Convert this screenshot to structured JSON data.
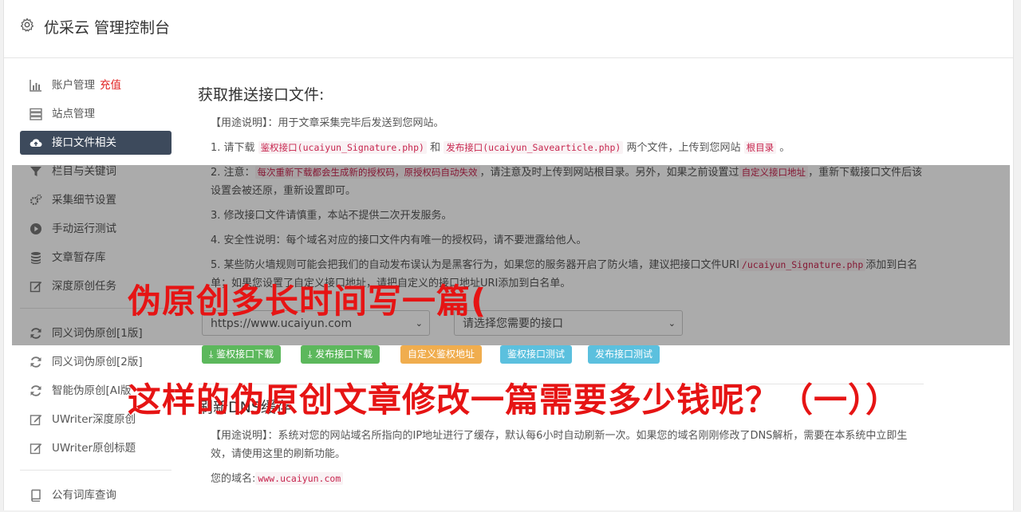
{
  "app": {
    "title": "优采云 管理控制台"
  },
  "sidebar": {
    "items": [
      {
        "label": "账户管理",
        "extra": "充值",
        "icon": "bar-chart-icon",
        "active": false
      },
      {
        "label": "站点管理",
        "icon": "server-icon",
        "active": false
      },
      {
        "label": "接口文件相关",
        "icon": "cloud-upload-icon",
        "active": true
      },
      {
        "label": "栏目与关键词",
        "icon": "filter-icon",
        "active": false
      },
      {
        "label": "采集细节设置",
        "icon": "cogs-icon",
        "active": false
      },
      {
        "label": "手动运行测试",
        "icon": "play-icon",
        "active": false
      },
      {
        "label": "文章暂存库",
        "icon": "database-icon",
        "active": false
      },
      {
        "label": "深度原创任务",
        "icon": "edit-icon",
        "active": false
      },
      {
        "label": "同义词伪原创[1版]",
        "icon": "refresh-icon",
        "active": false
      },
      {
        "label": "同义词伪原创[2版]",
        "icon": "refresh-icon",
        "active": false
      },
      {
        "label": "智能伪原创[AI版",
        "icon": "refresh-icon",
        "active": false
      },
      {
        "label": "UWriter深度原创",
        "icon": "edit-icon",
        "active": false
      },
      {
        "label": "UWriter原创标题",
        "icon": "edit-icon",
        "active": false
      },
      {
        "label": "公有词库查询",
        "icon": "book-icon",
        "active": false
      }
    ]
  },
  "main": {
    "section1": {
      "title": "获取推送接口文件:",
      "usage": "【用途说明】：用于文章采集完毕后发送到您网站。",
      "step1_a": "1. 请下载",
      "step1_code1": "鉴权接口(ucaiyun_Signature.php)",
      "step1_b": "和",
      "step1_code2": "发布接口(ucaiyun_Savearticle.php)",
      "step1_c": "两个文件，上传到您网站",
      "step1_code3": "根目录",
      "step1_d": "。",
      "step2_a": "2. 注意：",
      "step2_code1": "每次重新下载都会生成新的授权码，原授权码自动失效",
      "step2_b": "，请注意及时上传到网站根目录。另外，如果之前设置过",
      "step2_code2": "自定义接口地址",
      "step2_c": "，重新下载接口文件后该设置会被还原，重新设置即可。",
      "step3": "3. 修改接口文件请慎重，本站不提供二次开发服务。",
      "step4": "4. 安全性说明：每个域名对应的接口文件内有唯一的授权码，请不要泄露给他人。",
      "step5_a": "5. 某些防火墙规则可能会把我们的自动发布误认为是黑客行为，如果您的服务器开启了防火墙，建议把接口文件URI",
      "step5_code": "/ucaiyun_Signature.php",
      "step5_b": "添加到白名单；如果您设置了自定义接口地址，请把自定义的接口地址URI添加到白名单。",
      "select_domain": "https://www.ucaiyun.com",
      "select_api": "请选择您需要的接口",
      "btn_auth_download": "鉴权接口下载",
      "btn_publish_download": "发布接口下载",
      "btn_custom_auth": "自定义鉴权地址",
      "btn_auth_test": "鉴权接口测试",
      "btn_publish_test": "发布接口测试"
    },
    "section2": {
      "title": "刷新DNS缓存",
      "usage": "【用途说明】：系统对您的网站域名所指向的IP地址进行了缓存，默认每6小时自动刷新一次。如果您的域名刚刚修改了DNS解析，需要在本系统中立即生效，请使用这里的刷新功能。",
      "domain_label": "您的域名:",
      "domain_value": "www.ucaiyun.com"
    }
  },
  "overlay": {
    "headline1": "伪原创多长时间写一篇(",
    "headline2": "这样的伪原创文章修改一篇需要多少钱呢？（一））"
  },
  "colors": {
    "sidebar_active": "#3d4a5c",
    "recharge": "#e02020",
    "green": "#5cb85c",
    "orange": "#f0ad4e",
    "blue": "#5bc0de",
    "headline": "#e61414"
  }
}
